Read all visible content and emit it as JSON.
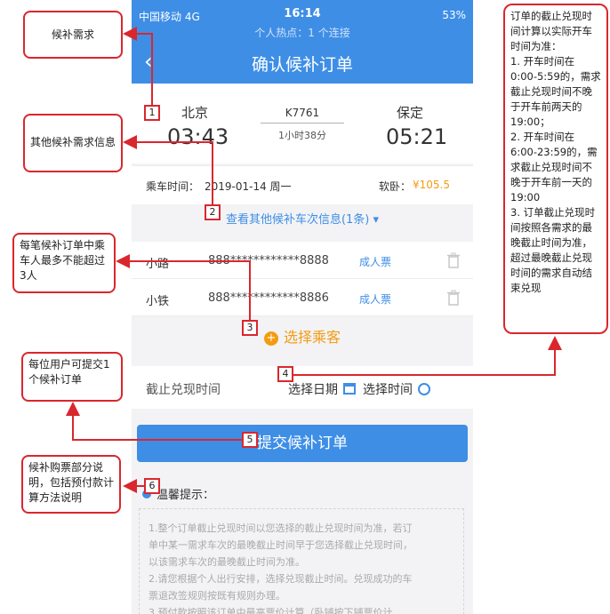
{
  "status_bar": {
    "carrier": "中国移动 4G",
    "time": "16:14",
    "right": "53%",
    "hotspot": "个人热点：1 个连接"
  },
  "nav": {
    "back": "‹",
    "title": "确认候补订单"
  },
  "trip": {
    "from_city": "北京",
    "from_time": "03:43",
    "to_city": "保定",
    "to_time": "05:21",
    "train_no": "K7761",
    "duration": "1小时38分"
  },
  "ride": {
    "date_label": "乘车时间：",
    "date_value": "2019-01-14 周一",
    "seat": "软卧：",
    "price": "¥105.5"
  },
  "other_trains_link": "查看其他候补车次信息(1条)",
  "passengers": [
    {
      "name": "小路",
      "id": "888************8888",
      "type": "成人票"
    },
    {
      "name": "小铁",
      "id": "888************8886",
      "type": "成人票"
    }
  ],
  "select_passenger": "选择乘客",
  "deadline": {
    "label": "截止兑现时间",
    "date_btn": "选择日期",
    "time_btn": "选择时间"
  },
  "submit_label": "提交候补订单",
  "tips": {
    "title": "温馨提示：",
    "lines": [
      "1.整个订单截止兑现时间以您选择的截止兑现时间为准，若订",
      "单中某一需求车次的最晚截止时间早于您选择截止兑现时间，",
      "以该需求车次的最晚截止时间为准。",
      "2.请您根据个人出行安排，选择兑现截止时间。兑现成功的车",
      "票退改签规则按既有规则办理。",
      "3.预付款按照该订单中最高票价计算（卧铺按下铺票价计"
    ]
  },
  "annotations": {
    "need": "候补需求",
    "other": "其他候补需求信息",
    "three": "每笔候补订单中乘车人最多不能超过3人",
    "user": "每位用户可提交1个候补订单",
    "desc": "候补购票部分说明，包括预付款计算方法说明",
    "rule": "订单的截止兑现时间计算以实际开车时间为准：\n1. 开车时间在0:00-5:59的，需求截止兑现时间不晚于开车前两天的19:00；\n2. 开车时间在6:00-23:59的，需求截止兑现时间不晚于开车前一天的19:00\n3. 订单截止兑现时间按照各需求的最晚截止时间为准，超过最晚截止兑现时间的需求自动结束兑现",
    "badges": [
      "1",
      "2",
      "3",
      "4",
      "5",
      "6"
    ]
  },
  "colors": {
    "primary": "#3e8ee6",
    "accent": "#f39c12",
    "annotation": "#d9272e"
  }
}
